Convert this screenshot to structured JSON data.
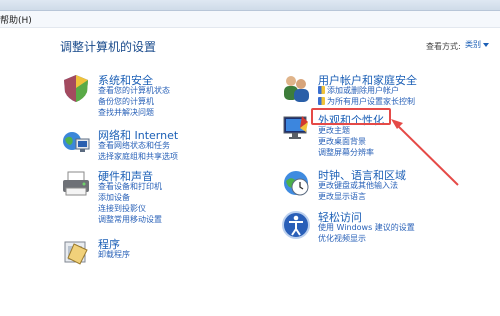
{
  "menubar": {
    "help": "帮助(H)"
  },
  "page_title": "调整计算机的设置",
  "view_by": {
    "label": "查看方式:",
    "value": "类别"
  },
  "categories": {
    "system_security": {
      "title": "系统和安全",
      "links": [
        "查看您的计算机状态",
        "备份您的计算机",
        "查找并解决问题"
      ]
    },
    "network_internet": {
      "title": "网络和 Internet",
      "links": [
        "查看网络状态和任务",
        "选择家庭组和共享选项"
      ]
    },
    "hardware_sound": {
      "title": "硬件和声音",
      "links": [
        "查看设备和打印机",
        "添加设备",
        "连接到投影仪",
        "调整常用移动设置"
      ]
    },
    "programs": {
      "title": "程序",
      "links": [
        "卸载程序"
      ]
    },
    "user_accounts": {
      "title": "用户帐户和家庭安全",
      "links": [
        "添加或删除用户帐户",
        "为所有用户设置家长控制"
      ]
    },
    "appearance": {
      "title": "外观和个性化",
      "links": [
        "更改主题",
        "更改桌面背景",
        "调整屏幕分辨率"
      ]
    },
    "clock_language": {
      "title": "时钟、语言和区域",
      "links": [
        "更改键盘或其他输入法",
        "更改显示语言"
      ]
    },
    "ease_access": {
      "title": "轻松访问",
      "links": [
        "使用 Windows 建议的设置",
        "优化视频显示"
      ]
    }
  },
  "colors": {
    "link": "#2a62b8",
    "heading": "#1b5fb6",
    "title": "#1a4b8c",
    "highlight": "#e54a47"
  }
}
